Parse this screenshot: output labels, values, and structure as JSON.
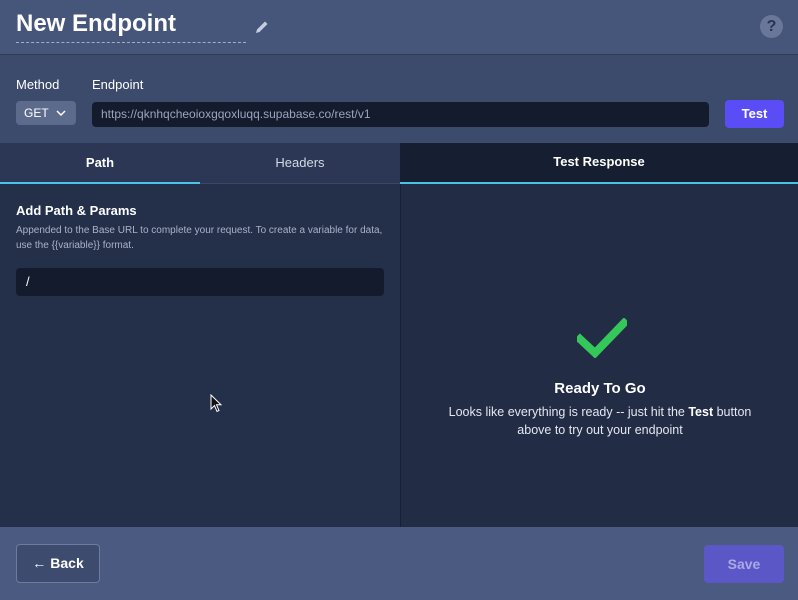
{
  "header": {
    "title": "New Endpoint",
    "edit_icon": "pencil-icon",
    "help_icon": "question-icon",
    "help_label": "?"
  },
  "config": {
    "method_label": "Method",
    "method_value": "GET",
    "endpoint_label": "Endpoint",
    "endpoint_value": "https://qknhqcheoioxgqoxluqq.supabase.co/rest/v1",
    "test_label": "Test"
  },
  "tabs": [
    {
      "label": "Path",
      "active": true
    },
    {
      "label": "Headers",
      "active": false
    }
  ],
  "response_tab": {
    "label": "Test Response"
  },
  "path_section": {
    "title": "Add Path & Params",
    "description": "Appended to the Base URL to complete your request. To create a variable for data, use the {{variable}} format.",
    "path_value": "/"
  },
  "response": {
    "icon": "checkmark-icon",
    "title": "Ready To Go",
    "desc_before": "Looks like everything is ready -- just hit the ",
    "desc_bold": "Test",
    "desc_after": " button above to try out your endpoint"
  },
  "footer": {
    "back_label": "Back",
    "save_label": "Save"
  },
  "colors": {
    "accent": "#5b4df5",
    "tab_underline": "#4cc3e6",
    "check": "#34c759"
  }
}
